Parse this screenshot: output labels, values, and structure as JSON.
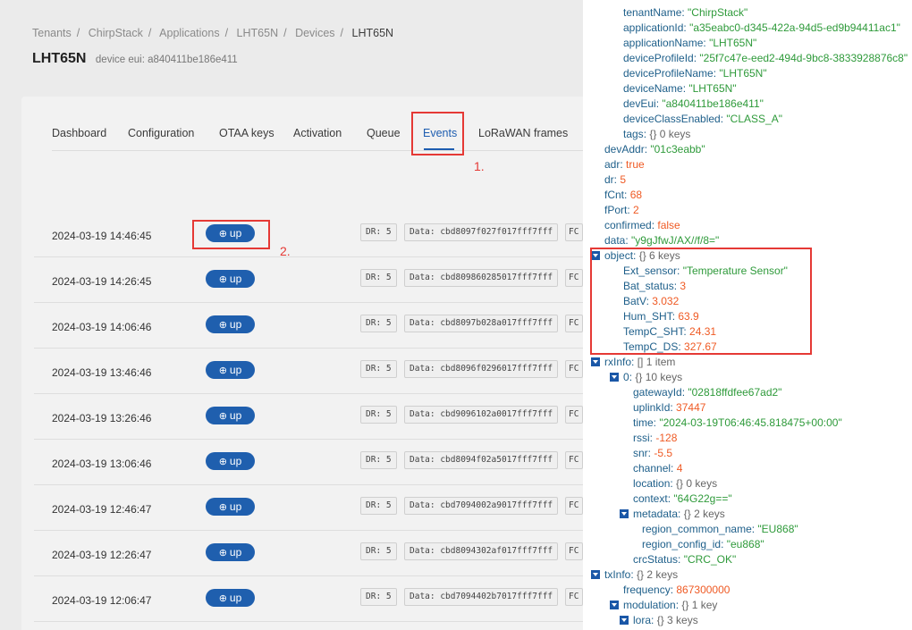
{
  "breadcrumb": [
    "Tenants",
    "ChirpStack",
    "Applications",
    "LHT65N",
    "Devices",
    "LHT65N"
  ],
  "device": {
    "name": "LHT65N",
    "eui_label": "device eui: a840411be186e411"
  },
  "tabs": [
    "Dashboard",
    "Configuration",
    "OTAA keys",
    "Activation",
    "Queue",
    "Events",
    "LoRaWAN frames"
  ],
  "active_tab": "Events",
  "annotations": {
    "events": "1.",
    "up_button": "2."
  },
  "events": [
    {
      "time": "2024-03-19 14:46:45",
      "type": "up",
      "dr": "DR: 5",
      "data": "Data: cbd8097f027f017fff7fff",
      "fc": "FC"
    },
    {
      "time": "2024-03-19 14:26:45",
      "type": "up",
      "dr": "DR: 5",
      "data": "Data: cbd809860285017fff7fff",
      "fc": "FC"
    },
    {
      "time": "2024-03-19 14:06:46",
      "type": "up",
      "dr": "DR: 5",
      "data": "Data: cbd8097b028a017fff7fff",
      "fc": "FC"
    },
    {
      "time": "2024-03-19 13:46:46",
      "type": "up",
      "dr": "DR: 5",
      "data": "Data: cbd8096f0296017fff7fff",
      "fc": "FC"
    },
    {
      "time": "2024-03-19 13:26:46",
      "type": "up",
      "dr": "DR: 5",
      "data": "Data: cbd9096102a0017fff7fff",
      "fc": "FC"
    },
    {
      "time": "2024-03-19 13:06:46",
      "type": "up",
      "dr": "DR: 5",
      "data": "Data: cbd8094f02a5017fff7fff",
      "fc": "FC"
    },
    {
      "time": "2024-03-19 12:46:47",
      "type": "up",
      "dr": "DR: 5",
      "data": "Data: cbd7094002a9017fff7fff",
      "fc": "FC"
    },
    {
      "time": "2024-03-19 12:26:47",
      "type": "up",
      "dr": "DR: 5",
      "data": "Data: cbd8094302af017fff7fff",
      "fc": "FC"
    },
    {
      "time": "2024-03-19 12:06:47",
      "type": "up",
      "dr": "DR: 5",
      "data": "Data: cbd7094402b7017fff7fff",
      "fc": "FC"
    }
  ],
  "json_view": [
    {
      "ind": 0,
      "key": "tenantName",
      "val": "\"ChirpStack\"",
      "t": "s"
    },
    {
      "ind": 0,
      "key": "applicationId",
      "val": "\"a35eabc0-d345-422a-94d5-ed9b94411ac1\"",
      "t": "s"
    },
    {
      "ind": 0,
      "key": "applicationName",
      "val": "\"LHT65N\"",
      "t": "s"
    },
    {
      "ind": 0,
      "key": "deviceProfileId",
      "val": "\"25f7c47e-eed2-494d-9bc8-3833928876c8\"",
      "t": "s"
    },
    {
      "ind": 0,
      "key": "deviceProfileName",
      "val": "\"LHT65N\"",
      "t": "s"
    },
    {
      "ind": 0,
      "key": "deviceName",
      "val": "\"LHT65N\"",
      "t": "s"
    },
    {
      "ind": 0,
      "key": "devEui",
      "val": "\"a840411be186e411\"",
      "t": "s"
    },
    {
      "ind": 0,
      "key": "deviceClassEnabled",
      "val": "\"CLASS_A\"",
      "t": "s"
    },
    {
      "ind": 0,
      "key": "tags",
      "val": "{}  0 keys",
      "t": "m"
    },
    {
      "ind": -1,
      "key": "devAddr",
      "val": "\"01c3eabb\"",
      "t": "s"
    },
    {
      "ind": -1,
      "key": "adr",
      "val": "true",
      "t": "b"
    },
    {
      "ind": -1,
      "key": "dr",
      "val": "5",
      "t": "n"
    },
    {
      "ind": -1,
      "key": "fCnt",
      "val": "68",
      "t": "n"
    },
    {
      "ind": -1,
      "key": "fPort",
      "val": "2",
      "t": "n"
    },
    {
      "ind": -1,
      "key": "confirmed",
      "val": "false",
      "t": "b"
    },
    {
      "ind": -1,
      "key": "data",
      "val": "\"y9gJfwJ/AX//f/8=\"",
      "t": "s"
    },
    {
      "ind": -1,
      "key": "object",
      "val": "{}  6 keys",
      "t": "m",
      "tog": true
    },
    {
      "ind": 0,
      "key": "Ext_sensor",
      "val": "\"Temperature Sensor\"",
      "t": "s"
    },
    {
      "ind": 0,
      "key": "Bat_status",
      "val": "3",
      "t": "n"
    },
    {
      "ind": 0,
      "key": "BatV",
      "val": "3.032",
      "t": "n"
    },
    {
      "ind": 0,
      "key": "Hum_SHT",
      "val": "63.9",
      "t": "n"
    },
    {
      "ind": 0,
      "key": "TempC_SHT",
      "val": "24.31",
      "t": "n"
    },
    {
      "ind": 0,
      "key": "TempC_DS",
      "val": "327.67",
      "t": "n"
    },
    {
      "ind": -1,
      "key": "rxInfo",
      "val": "[]  1 item",
      "t": "m",
      "tog": true
    },
    {
      "ind": 0,
      "key": "0",
      "val": "{}  10 keys",
      "t": "m",
      "tog": true
    },
    {
      "ind": 1,
      "key": "gatewayId",
      "val": "\"02818ffdfee67ad2\"",
      "t": "s"
    },
    {
      "ind": 1,
      "key": "uplinkId",
      "val": "37447",
      "t": "n"
    },
    {
      "ind": 1,
      "key": "time",
      "val": "\"2024-03-19T06:46:45.818475+00:00\"",
      "t": "s"
    },
    {
      "ind": 1,
      "key": "rssi",
      "val": "-128",
      "t": "n"
    },
    {
      "ind": 1,
      "key": "snr",
      "val": "-5.5",
      "t": "n"
    },
    {
      "ind": 1,
      "key": "channel",
      "val": "4",
      "t": "n"
    },
    {
      "ind": 1,
      "key": "location",
      "val": "{}  0 keys",
      "t": "m"
    },
    {
      "ind": 1,
      "key": "context",
      "val": "\"64G22g==\"",
      "t": "s"
    },
    {
      "ind": 1,
      "key": "metadata",
      "val": "{}  2 keys",
      "t": "m",
      "tog": true
    },
    {
      "ind": 2,
      "key": "region_common_name",
      "val": "\"EU868\"",
      "t": "s"
    },
    {
      "ind": 2,
      "key": "region_config_id",
      "val": "\"eu868\"",
      "t": "s"
    },
    {
      "ind": 1,
      "key": "crcStatus",
      "val": "\"CRC_OK\"",
      "t": "s"
    },
    {
      "ind": -1,
      "key": "txInfo",
      "val": "{}  2 keys",
      "t": "m",
      "tog": true
    },
    {
      "ind": 0,
      "key": "frequency",
      "val": "867300000",
      "t": "n"
    },
    {
      "ind": 0,
      "key": "modulation",
      "val": "{}  1 key",
      "t": "m",
      "tog": true
    },
    {
      "ind": 1,
      "key": "lora",
      "val": "{}  3 keys",
      "t": "m",
      "tog": true
    }
  ],
  "colors": {
    "accent": "#1f5fae",
    "annotation": "#e53935",
    "json_key": "#1e5f8a",
    "json_string": "#2e9a3a",
    "json_number": "#ef5a24"
  }
}
